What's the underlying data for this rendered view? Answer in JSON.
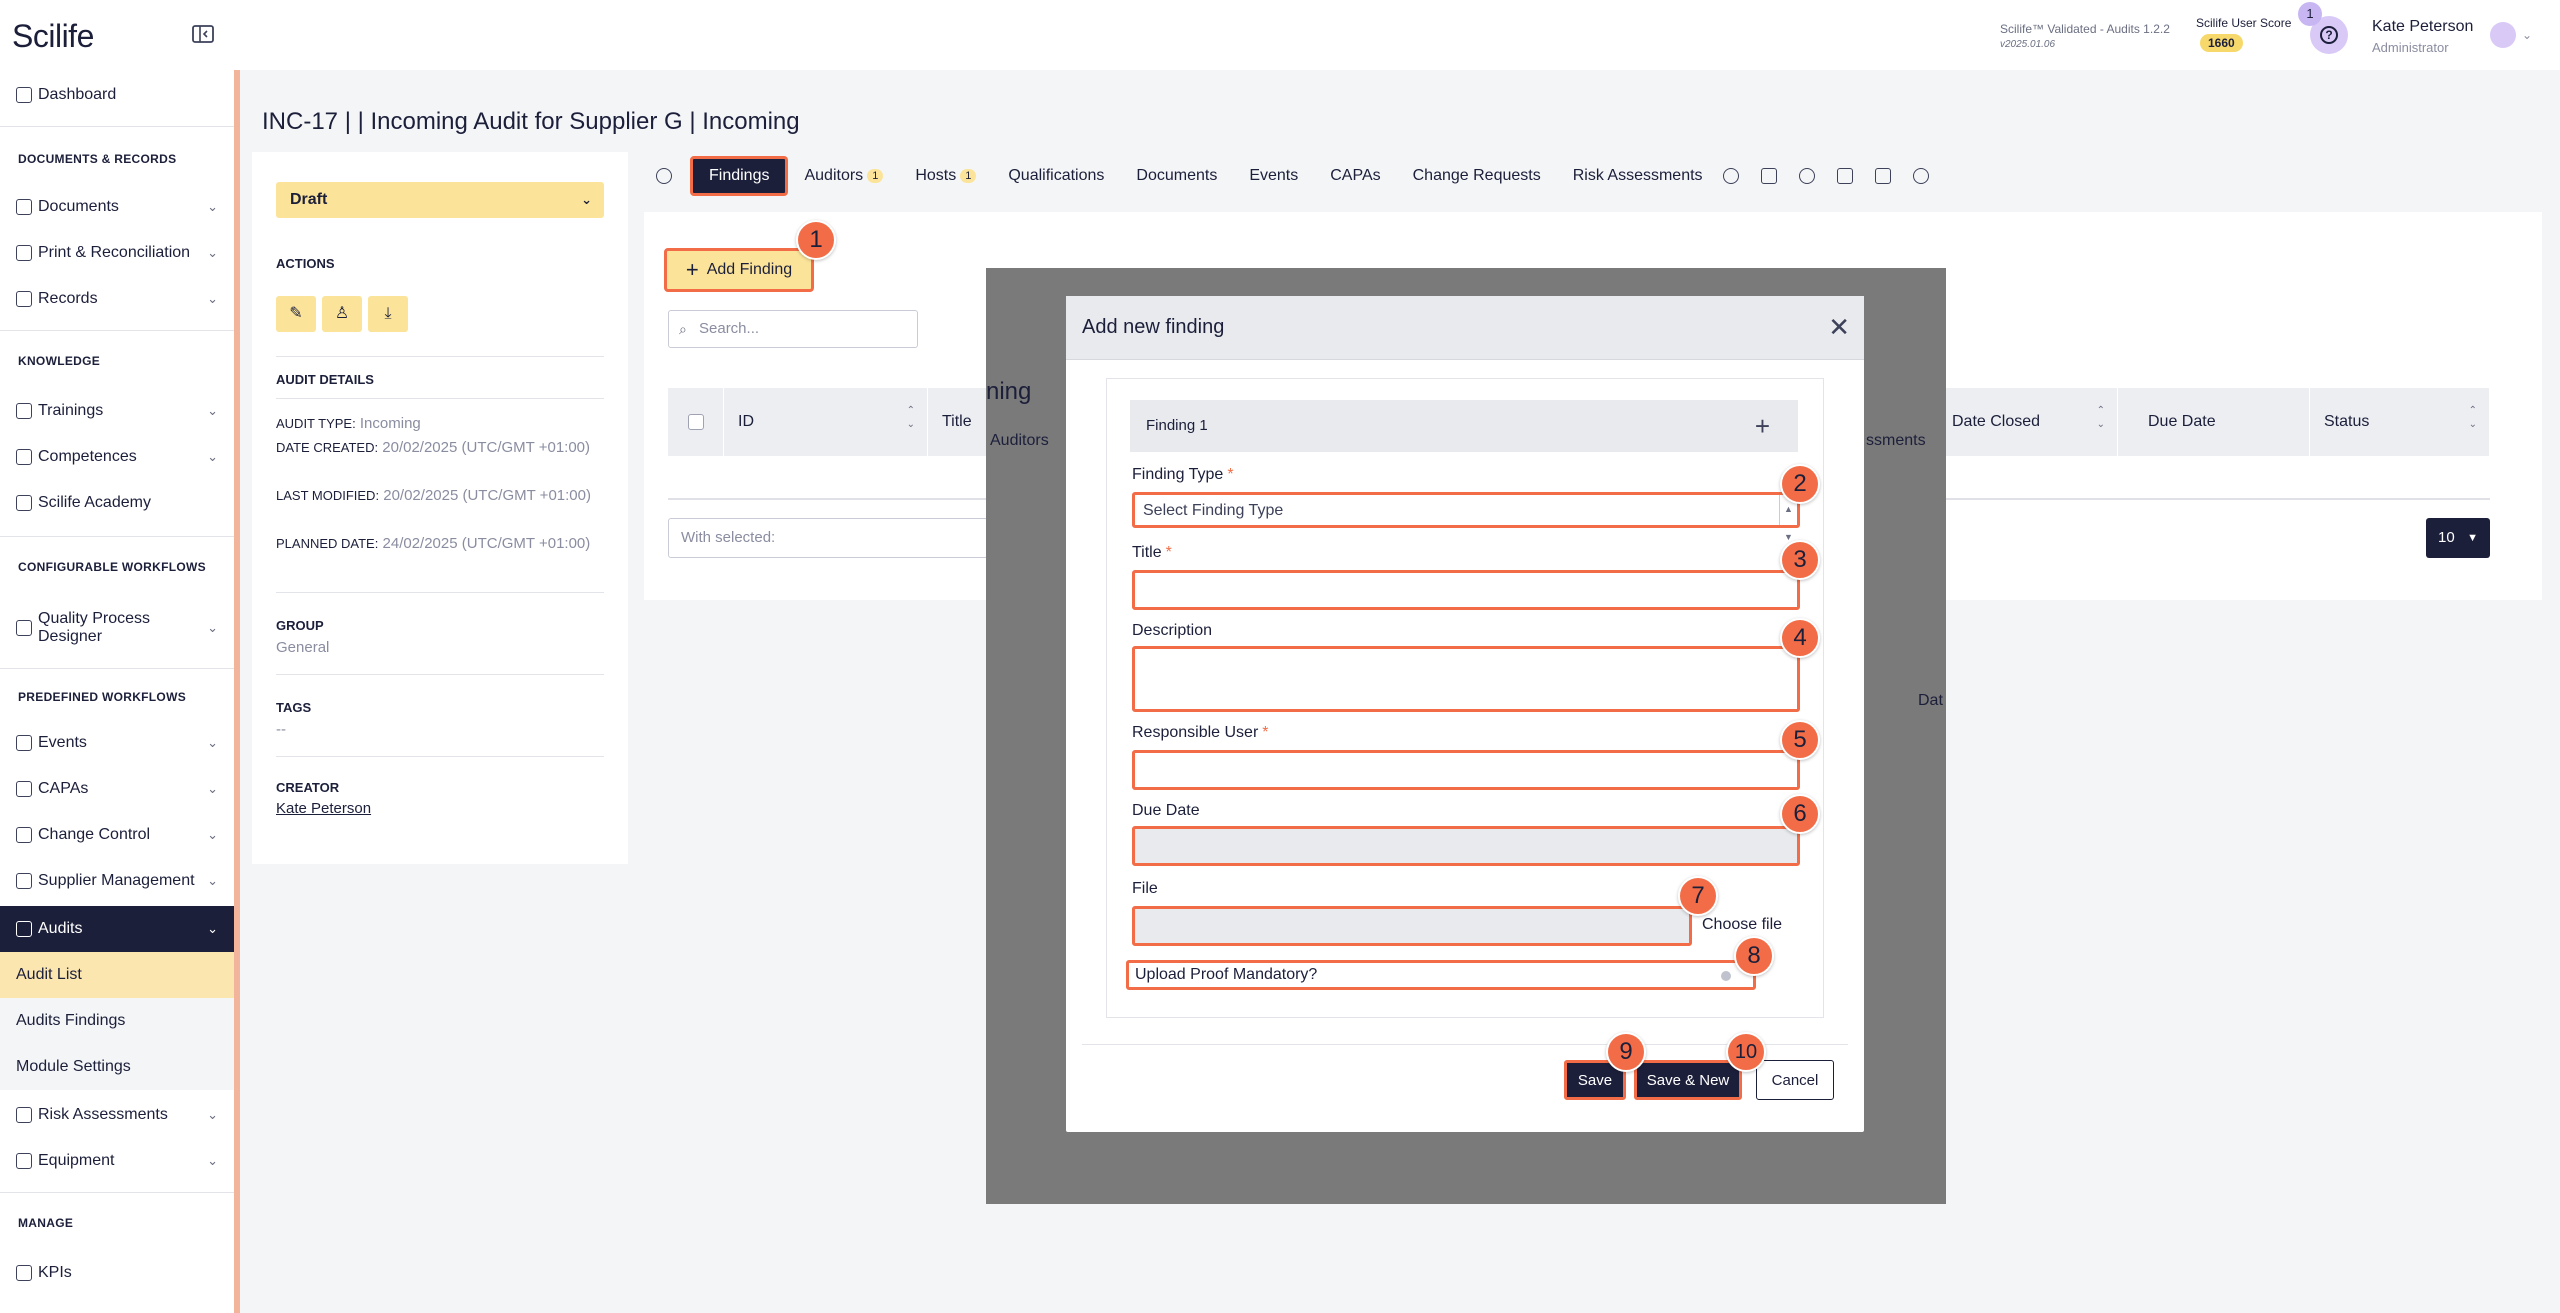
{
  "topbar": {
    "logo": "Scilife",
    "version_line": "Scilife™ Validated - Audits 1.2.2",
    "version_sub": "v2025.01.06",
    "score_label": "Scilife User Score",
    "score_value": "1660",
    "notification_count": "1",
    "help_glyph": "?",
    "user_name": "Kate Peterson",
    "user_role": "Administrator"
  },
  "sidebar": {
    "dashboard": "Dashboard",
    "section_docs": "DOCUMENTS & RECORDS",
    "documents": "Documents",
    "print": "Print & Reconciliation",
    "records": "Records",
    "section_knowledge": "KNOWLEDGE",
    "trainings": "Trainings",
    "competences": "Competences",
    "academy": "Scilife Academy",
    "section_config": "CONFIGURABLE WORKFLOWS",
    "qpd": "Quality Process Designer",
    "section_predef": "PREDEFINED WORKFLOWS",
    "events": "Events",
    "capas": "CAPAs",
    "change_control": "Change Control",
    "supplier": "Supplier Management",
    "audits": "Audits",
    "audit_list": "Audit List",
    "audits_findings": "Audits Findings",
    "module_settings": "Module Settings",
    "risk": "Risk Assessments",
    "equipment": "Equipment",
    "section_manage": "MANAGE",
    "kpis": "KPIs"
  },
  "page": {
    "title": "INC-17 |  |  Incoming Audit for Supplier G |  Incoming"
  },
  "left_panel": {
    "status": "Draft",
    "actions_label": "ACTIONS",
    "details_label": "AUDIT DETAILS",
    "audit_type_label": "AUDIT TYPE:",
    "audit_type_value": "Incoming",
    "date_created_label": "DATE CREATED:",
    "date_created_value": "20/02/2025 (UTC/GMT +01:00)",
    "last_modified_label": "LAST MODIFIED:",
    "last_modified_value": "20/02/2025 (UTC/GMT +01:00)",
    "planned_date_label": "PLANNED DATE:",
    "planned_date_value": "24/02/2025 (UTC/GMT +01:00)",
    "group_label": "GROUP",
    "group_value": "General",
    "tags_label": "TAGS",
    "tags_value": "--",
    "creator_label": "CREATOR",
    "creator_value": "Kate Peterson"
  },
  "tabs": {
    "findings": "Findings",
    "auditors": "Auditors",
    "auditors_count": "1",
    "hosts": "Hosts",
    "hosts_count": "1",
    "qualifications": "Qualifications",
    "documents": "Documents",
    "events": "Events",
    "capas": "CAPAs",
    "change_requests": "Change Requests",
    "risk_assessments": "Risk Assessments"
  },
  "findings_panel": {
    "add_finding": "Add Finding",
    "search_placeholder": "Search...",
    "columns": [
      "ID",
      "Title",
      "Date Closed",
      "Due Date",
      "Status"
    ],
    "with_selected": "With selected:",
    "per_page": "10",
    "background_partial_texts": [
      "ning",
      "Auditors",
      "ssments",
      "Dat"
    ]
  },
  "modal": {
    "title": "Add new finding",
    "card_title": "Finding 1",
    "finding_type_label": "Finding Type",
    "finding_type_placeholder": "Select Finding Type",
    "title_label": "Title",
    "description_label": "Description",
    "responsible_label": "Responsible User",
    "due_date_label": "Due Date",
    "file_label": "File",
    "choose_file": "Choose file",
    "upload_proof_label": "Upload Proof Mandatory?",
    "save": "Save",
    "save_new": "Save & New",
    "cancel": "Cancel",
    "required_mark": "*"
  },
  "markers": [
    "1",
    "2",
    "3",
    "4",
    "5",
    "6",
    "7",
    "8",
    "9",
    "10"
  ],
  "colors": {
    "navy": "#1c1f3a",
    "accent_yellow": "#fbe49a",
    "highlight_orange": "#f26d47",
    "sidebar_border": "#f2b49a"
  }
}
